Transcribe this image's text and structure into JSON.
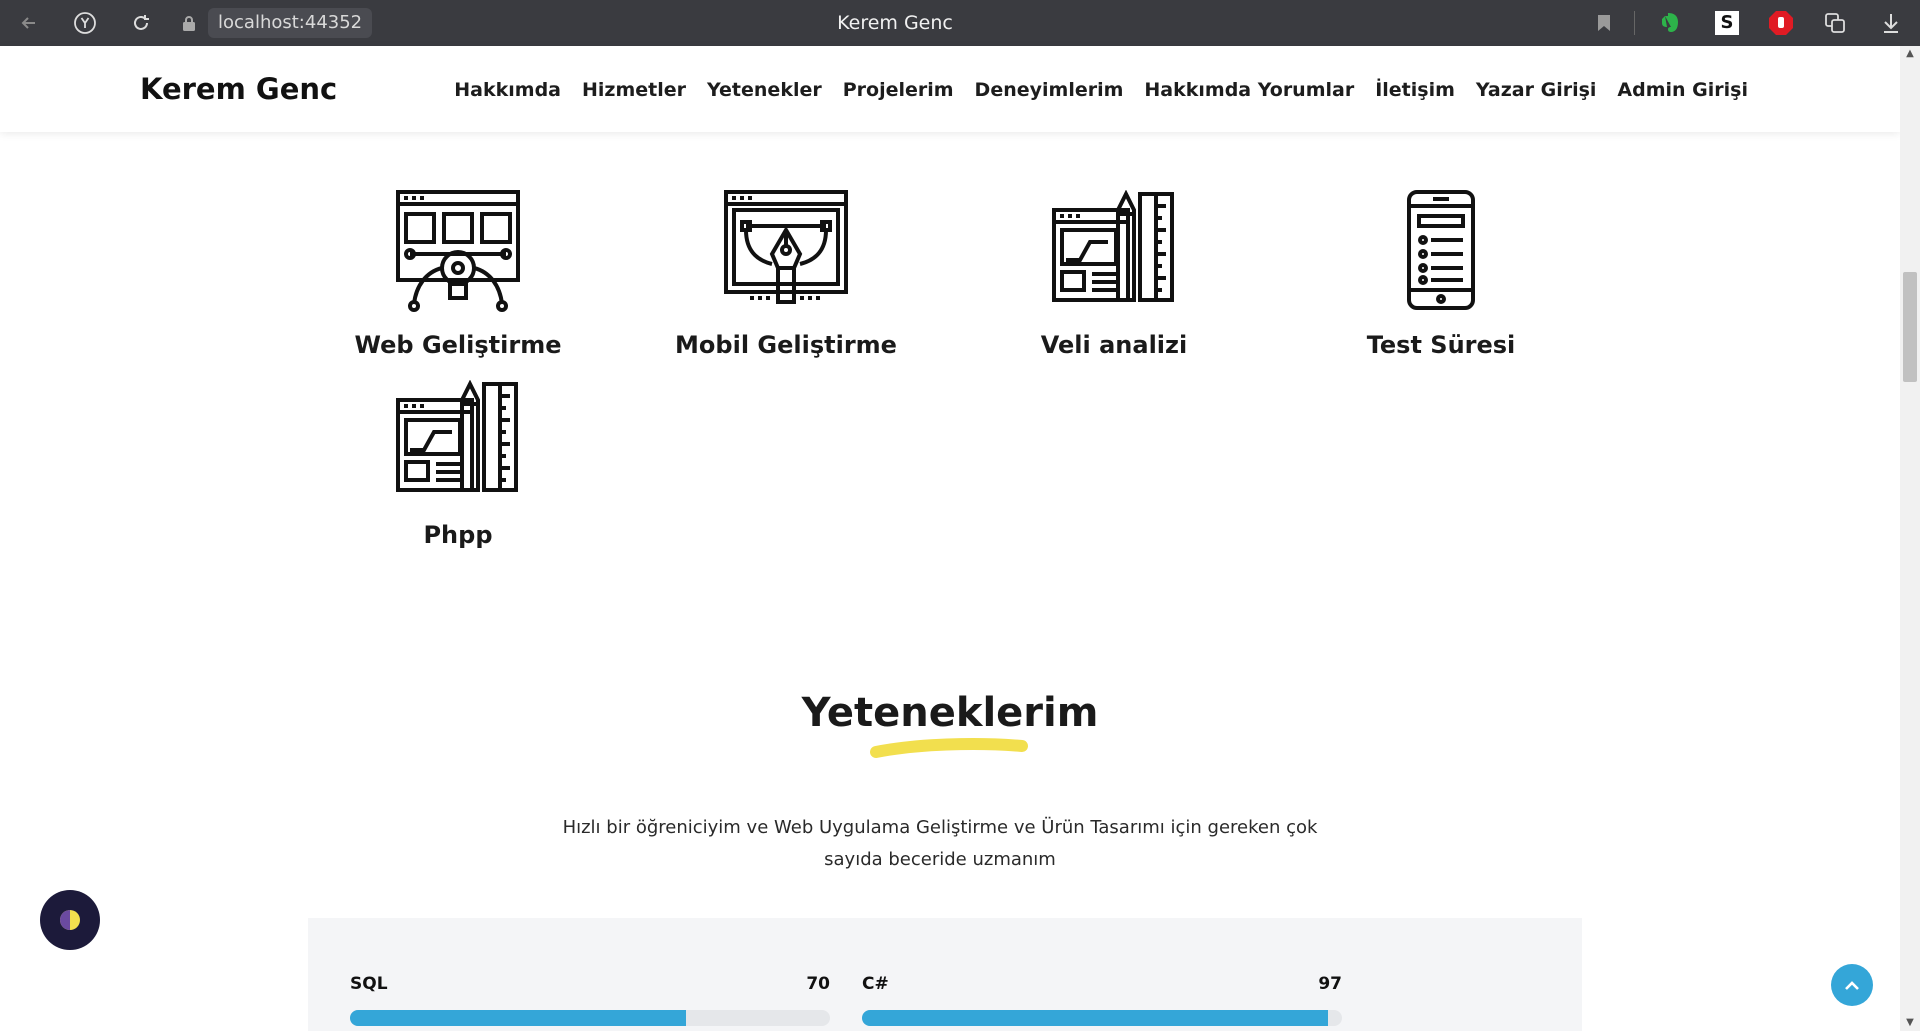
{
  "browser": {
    "url": "localhost:44352",
    "tab_title": "Kerem Genc"
  },
  "nav": {
    "brand": "Kerem Genc",
    "links": [
      "Hakkımda",
      "Hizmetler",
      "Yetenekler",
      "Projelerim",
      "Deneyimlerim",
      "Hakkımda Yorumlar",
      "İletişim",
      "Yazar Girişi",
      "Admin Girişi"
    ]
  },
  "services": [
    {
      "label": "Web Geliştirme",
      "icon": "web-development-icon"
    },
    {
      "label": "Mobil Geliştirme",
      "icon": "mobile-design-icon"
    },
    {
      "label": "Veli analizi",
      "icon": "design-tools-icon"
    },
    {
      "label": "Test Süresi",
      "icon": "smartphone-list-icon"
    },
    {
      "label": "Phpp",
      "icon": "design-tools-icon"
    }
  ],
  "skills_section": {
    "title": "Yeteneklerim",
    "description": "Hızlı bir öğreniciyim ve Web Uygulama Geliştirme ve Ürün Tasarımı için gereken çok sayıda beceride uzmanım",
    "skills": [
      {
        "name": "SQL",
        "value": "70",
        "percent": 70
      },
      {
        "name": "C#",
        "value": "97",
        "percent": 97
      }
    ]
  },
  "colors": {
    "accent": "#34a6d8",
    "underline": "#f2df4e",
    "theme_button": "#1c1a3a"
  }
}
